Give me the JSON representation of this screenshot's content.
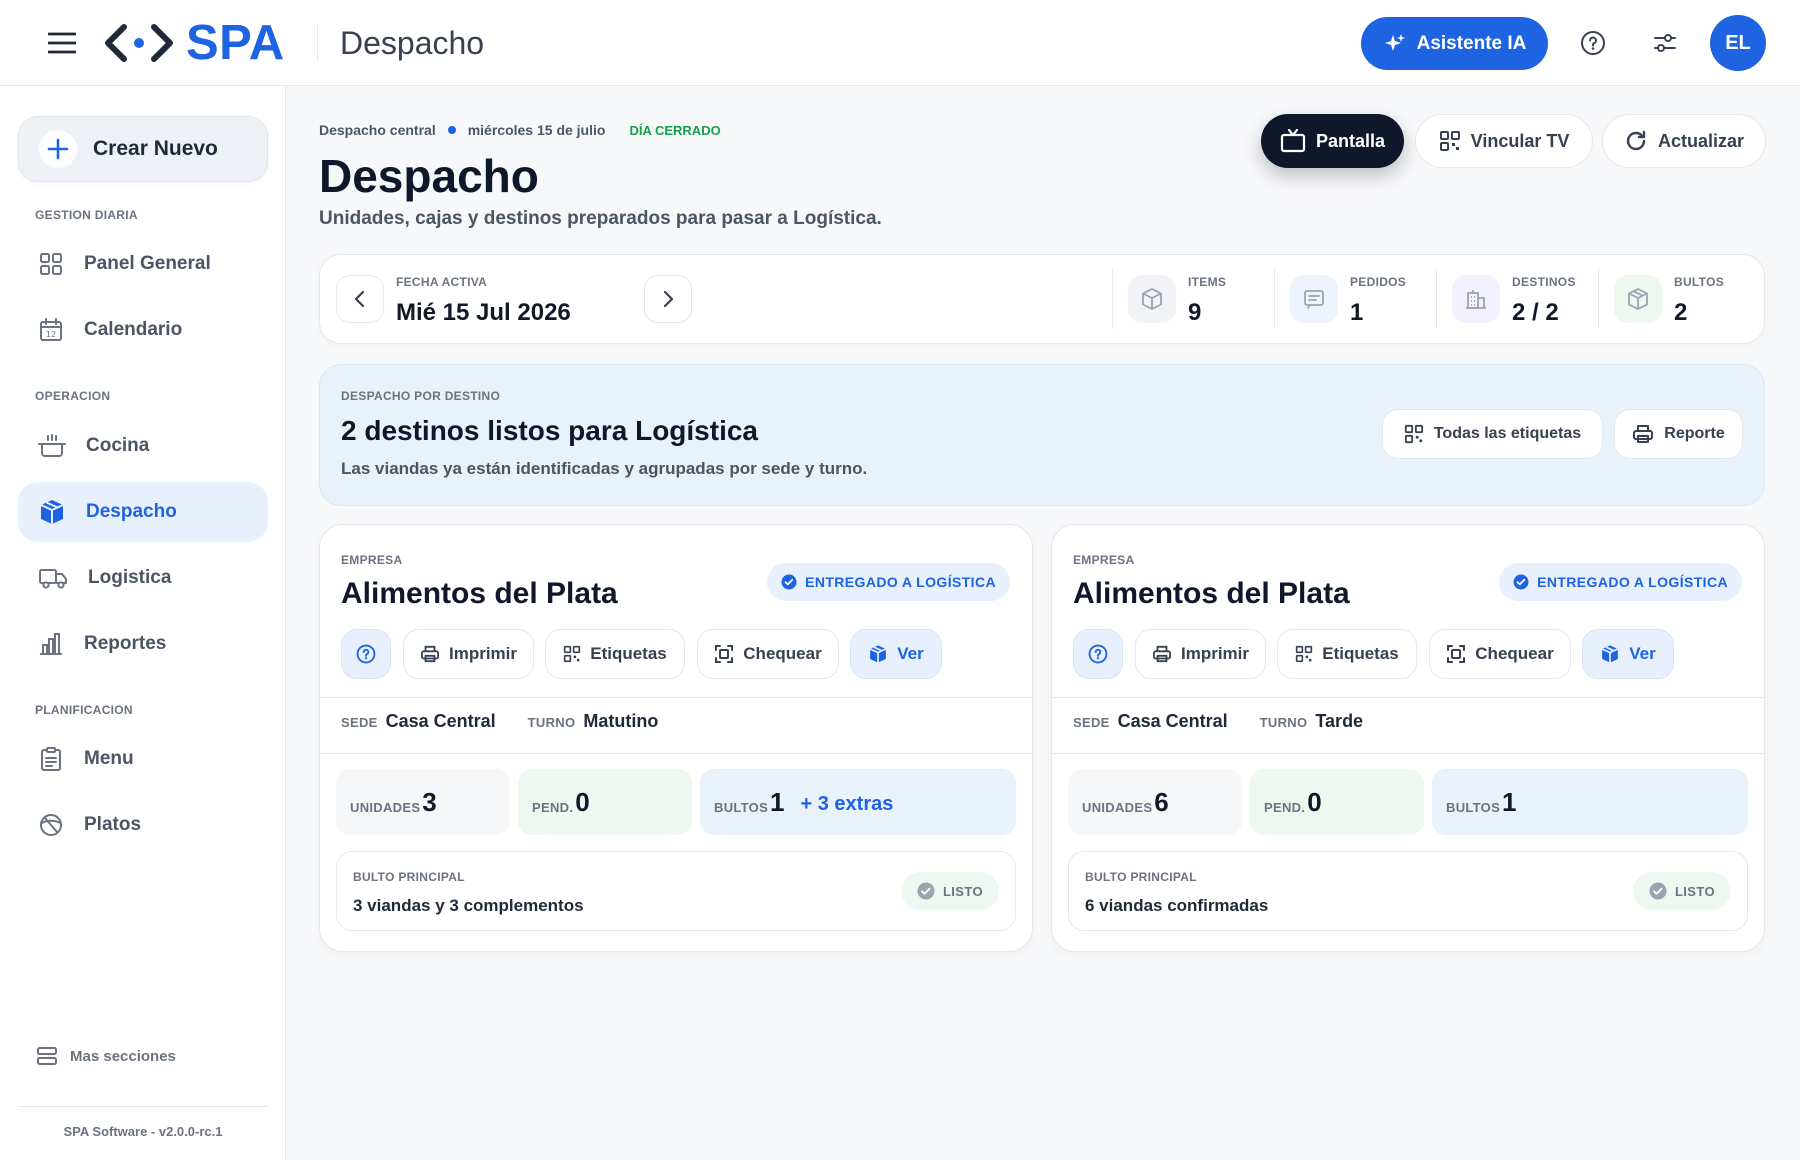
{
  "topbar": {
    "logo": "SPA",
    "title": "Despacho",
    "ai_button": "Asistente IA",
    "avatar_initials": "EL"
  },
  "sidebar": {
    "create_label": "Crear Nuevo",
    "sections": {
      "gestion": "GESTION DIARIA",
      "operacion": "OPERACION",
      "planificacion": "PLANIFICACION"
    },
    "items": [
      {
        "label": "Panel General",
        "icon": "grid-icon"
      },
      {
        "label": "Calendario",
        "icon": "calendar-icon"
      },
      {
        "label": "Cocina",
        "icon": "pot-icon"
      },
      {
        "label": "Despacho",
        "icon": "box-icon",
        "active": true
      },
      {
        "label": "Logistica",
        "icon": "truck-icon"
      },
      {
        "label": "Reportes",
        "icon": "bar-chart-icon"
      },
      {
        "label": "Menu",
        "icon": "clipboard-icon"
      },
      {
        "label": "Platos",
        "icon": "dish-icon"
      }
    ],
    "more_sections": "Mas secciones",
    "version": "SPA Software - v2.0.0-rc.1"
  },
  "header": {
    "breadcrumb_location": "Despacho central",
    "breadcrumb_date": "miércoles 15 de julio",
    "day_status": "DÍA CERRADO",
    "title": "Despacho",
    "subtitle": "Unidades, cajas y destinos preparados para pasar a Logística.",
    "buttons": {
      "screen": "Pantalla",
      "link_tv": "Vincular TV",
      "refresh": "Actualizar"
    }
  },
  "datebar": {
    "label": "FECHA ACTIVA",
    "value": "Mié 15 Jul 2026",
    "stats": [
      {
        "label": "ITEMS",
        "value": "9",
        "icon": "cube-icon",
        "color": "#f1f3f6"
      },
      {
        "label": "PEDIDOS",
        "value": "1",
        "icon": "message-icon",
        "color": "#eef3fc"
      },
      {
        "label": "DESTINOS",
        "value": "2 / 2",
        "icon": "building-icon",
        "color": "#f3f1fb"
      },
      {
        "label": "BULTOS",
        "value": "2",
        "icon": "package-icon",
        "color": "#eef8f1"
      }
    ]
  },
  "banner": {
    "eyebrow": "DESPACHO POR DESTINO",
    "title": "2 destinos listos para Logística",
    "subtitle": "Las viandas ya están identificadas y agrupadas por sede y turno.",
    "all_labels": "Todas las etiquetas",
    "report": "Reporte"
  },
  "cards": [
    {
      "eyebrow": "EMPRESA",
      "company": "Alimentos del Plata",
      "status": "ENTREGADO A LOGÍSTICA",
      "actions": {
        "print": "Imprimir",
        "labels": "Etiquetas",
        "check": "Chequear",
        "view": "Ver"
      },
      "sede_label": "SEDE",
      "sede": "Casa Central",
      "turno_label": "TURNO",
      "turno": "Matutino",
      "units_label": "UNIDADES",
      "units": "3",
      "pending_label": "PEND.",
      "pending": "0",
      "bultos_label": "BULTOS",
      "bultos": "1",
      "extras": "+ 3 extras",
      "main_label": "BULTO PRINCIPAL",
      "main_desc": "3 viandas y 3 complementos",
      "ready": "LISTO"
    },
    {
      "eyebrow": "EMPRESA",
      "company": "Alimentos del Plata",
      "status": "ENTREGADO A LOGÍSTICA",
      "actions": {
        "print": "Imprimir",
        "labels": "Etiquetas",
        "check": "Chequear",
        "view": "Ver"
      },
      "sede_label": "SEDE",
      "sede": "Casa Central",
      "turno_label": "TURNO",
      "turno": "Tarde",
      "units_label": "UNIDADES",
      "units": "6",
      "pending_label": "PEND.",
      "pending": "0",
      "bultos_label": "BULTOS",
      "bultos": "1",
      "main_label": "BULTO PRINCIPAL",
      "main_desc": "6 viandas confirmadas",
      "ready": "LISTO"
    }
  ],
  "colors": {
    "brand": "#1d63e2",
    "success": "#15a04a",
    "dark": "#0f172a"
  }
}
